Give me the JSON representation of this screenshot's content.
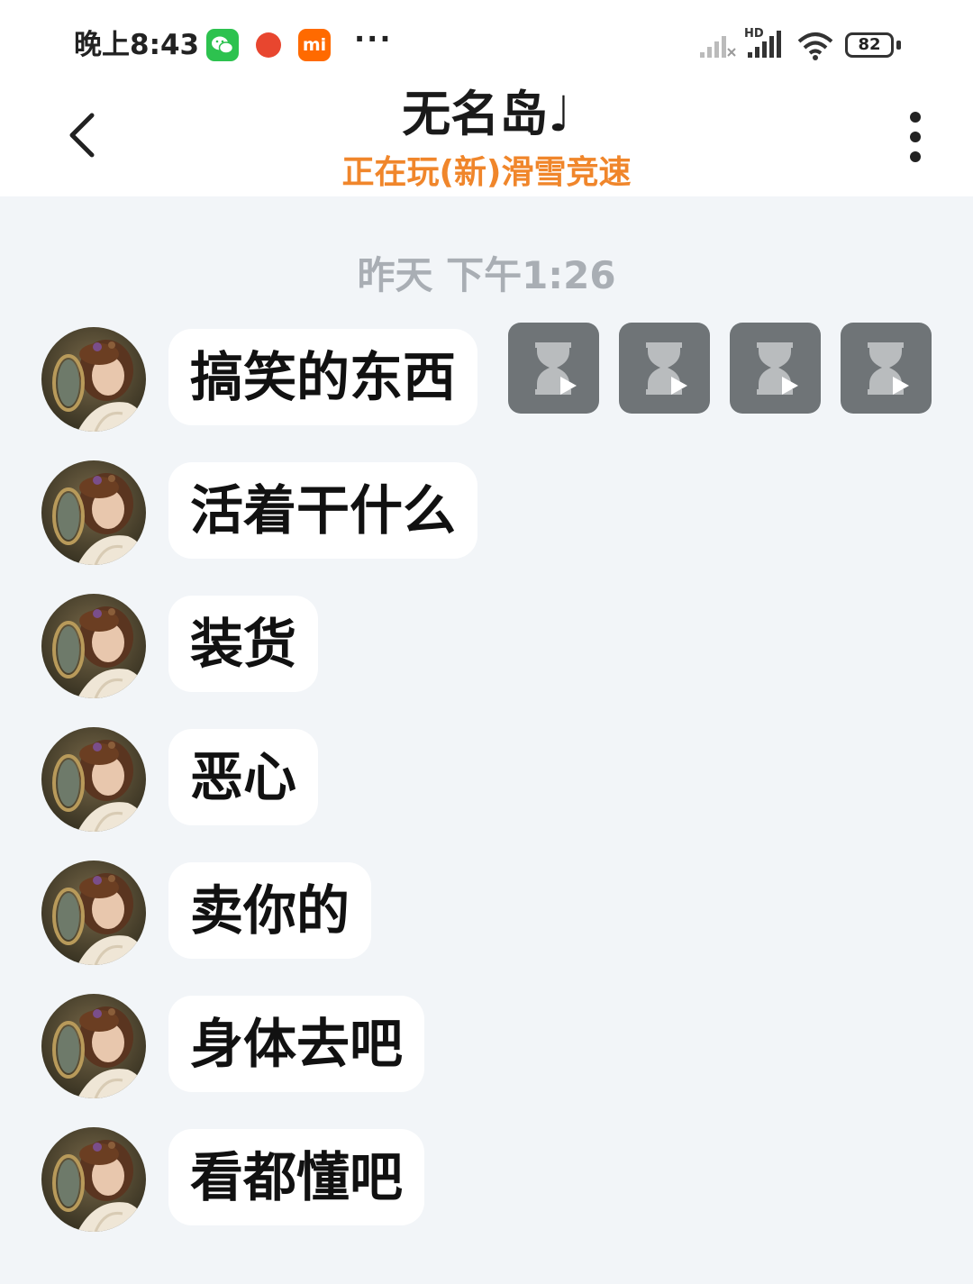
{
  "status_bar": {
    "time": "晚上8:43",
    "more": "···",
    "mi_label": "mi",
    "signal1_label": "HD",
    "battery": "82"
  },
  "header": {
    "title": "无名岛♩",
    "subtitle": "正在玩(新)滑雪竞速"
  },
  "chat": {
    "timestamp": "昨天  下午1:26",
    "messages": [
      {
        "text": "搞笑的东西"
      },
      {
        "text": "活着干什么"
      },
      {
        "text": "装货"
      },
      {
        "text": "恶心"
      },
      {
        "text": "卖你的"
      },
      {
        "text": "身体去吧"
      },
      {
        "text": "看都懂吧"
      }
    ],
    "stickers": [
      "loading-sticker-icon",
      "loading-sticker-icon",
      "loading-sticker-icon",
      "loading-sticker-icon"
    ]
  },
  "colors": {
    "subtitle": "#f0862b",
    "background": "#f2f5f8",
    "sticker": "#6f7477"
  }
}
